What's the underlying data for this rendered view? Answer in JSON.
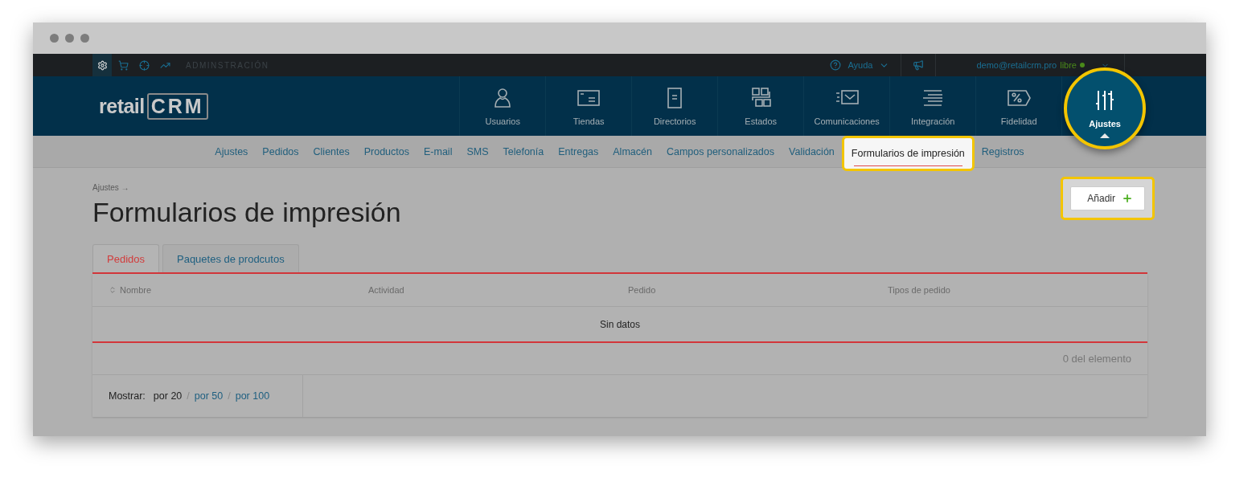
{
  "top_bar": {
    "modules": [
      {
        "kind": "gear",
        "selected": true
      },
      {
        "kind": "cart",
        "selected": false
      },
      {
        "kind": "target",
        "selected": false
      },
      {
        "kind": "chart",
        "selected": false
      }
    ],
    "section": "ADMINSTRACIÓN",
    "help": "Ayuda",
    "user": "demo@retailcrm.pro",
    "plan": "libre"
  },
  "logo": {
    "text": "retail",
    "mark": "CRM"
  },
  "nav": [
    {
      "label": "Usuarios",
      "kind": "user",
      "selected": false
    },
    {
      "label": "Tiendas",
      "kind": "store",
      "selected": false
    },
    {
      "label": "Directorios",
      "kind": "document",
      "selected": false
    },
    {
      "label": "Estados",
      "kind": "grid",
      "selected": false
    },
    {
      "label": "Comunicaciones",
      "kind": "mail",
      "selected": false
    },
    {
      "label": "Integración",
      "kind": "lines",
      "selected": false
    },
    {
      "label": "Fidelidad",
      "kind": "percent",
      "selected": false
    },
    {
      "label": "Ajustes",
      "kind": "sliders",
      "selected": true
    }
  ],
  "sub_nav": [
    {
      "label": "Ajustes",
      "selected": false
    },
    {
      "label": "Pedidos",
      "selected": false
    },
    {
      "label": "Clientes",
      "selected": false
    },
    {
      "label": "Productos",
      "selected": false
    },
    {
      "label": "E-mail",
      "selected": false
    },
    {
      "label": "SMS",
      "selected": false
    },
    {
      "label": "Telefonía",
      "selected": false
    },
    {
      "label": "Entregas",
      "selected": false
    },
    {
      "label": "Almacén",
      "selected": false
    },
    {
      "label": "Campos personalizados",
      "selected": false
    },
    {
      "label": "Validación",
      "selected": false
    },
    {
      "label": "Formularios de impresión",
      "selected": true
    },
    {
      "label": "Registros",
      "selected": false
    }
  ],
  "breadcrumb": "Ajustes →",
  "title": "Formularios de impresión",
  "add_button": {
    "label": "Añadir",
    "highlighted": true
  },
  "tabs": [
    {
      "label": "Pedidos",
      "selected": true
    },
    {
      "label": "Paquetes de prodcutos",
      "selected": false
    }
  ],
  "table": {
    "columns": [
      {
        "label": "Nombre",
        "sortable": true
      },
      {
        "label": "Actividad",
        "sortable": false
      },
      {
        "label": "Pedido",
        "sortable": false
      },
      {
        "label": "Tipos de pedido",
        "sortable": false
      }
    ],
    "empty": "Sin datos",
    "count": "0 del elemento"
  },
  "pager": {
    "label": "Mostrar:",
    "separator": "/",
    "options": [
      {
        "label": "por 20",
        "selected": true
      },
      {
        "label": "por 50",
        "selected": false
      },
      {
        "label": "por 100",
        "selected": false
      }
    ]
  }
}
